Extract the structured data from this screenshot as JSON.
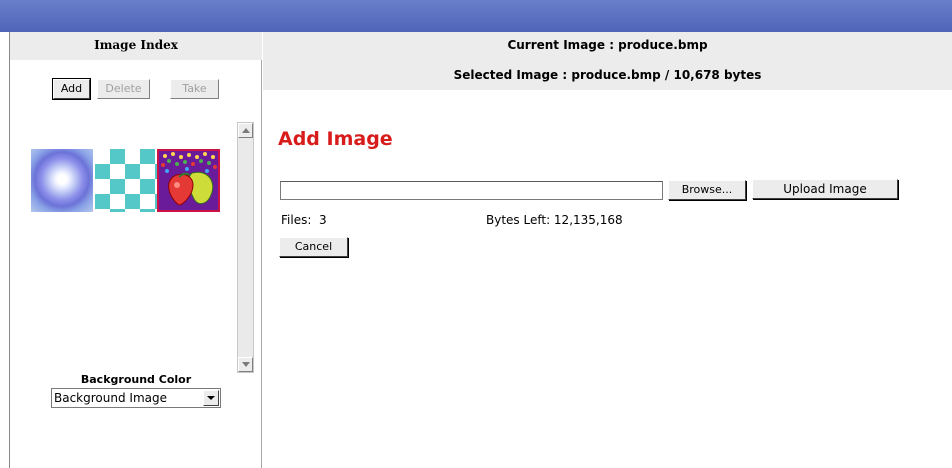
{
  "sidebar": {
    "title": "Image Index",
    "buttons": {
      "add": "Add",
      "delete": "Delete",
      "take": "Take"
    },
    "thumbnails": [
      {
        "name": "sun-thumbnail"
      },
      {
        "name": "checker-thumbnail"
      },
      {
        "name": "produce.bmp",
        "selected": true
      }
    ],
    "background_label": "Background Color",
    "background_select_value": "Background Image"
  },
  "header": {
    "current_image": "Current Image : produce.bmp",
    "selected_image": "Selected Image : produce.bmp / 10,678 bytes"
  },
  "main": {
    "title": "Add Image",
    "browse_label": "Browse...",
    "upload_label": "Upload Image",
    "files_text": "Files:  3",
    "bytes_left_text": "Bytes Left: 12,135,168",
    "cancel_label": "Cancel"
  },
  "colors": {
    "topbar": "#5a6fc0",
    "title_red": "#d81b1b",
    "selected_border": "#cc1144"
  }
}
